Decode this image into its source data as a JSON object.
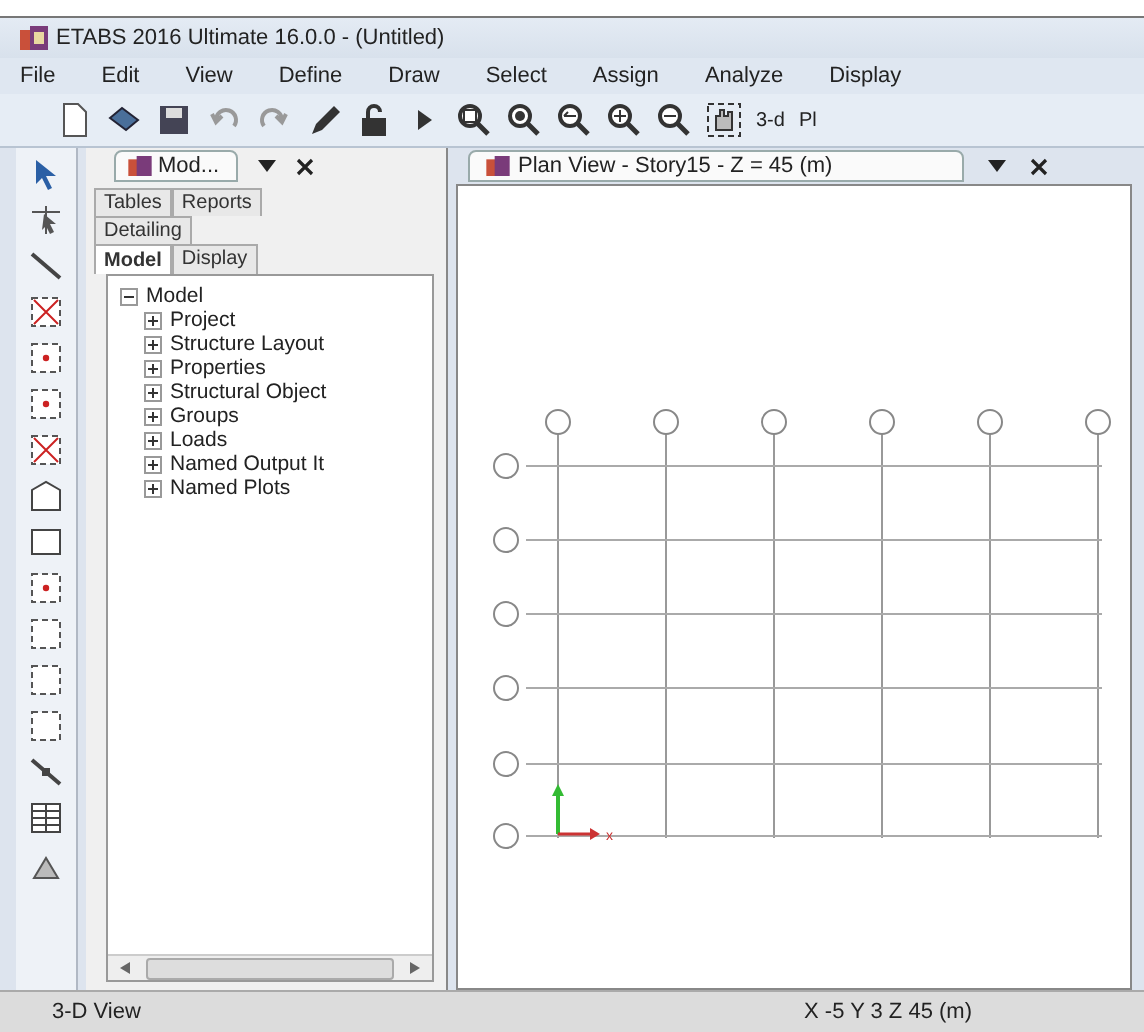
{
  "window": {
    "title": "ETABS 2016 Ultimate 16.0.0 - (Untitled)"
  },
  "menu": [
    "File",
    "Edit",
    "View",
    "Define",
    "Draw",
    "Select",
    "Assign",
    "Analyze",
    "Display"
  ],
  "toolbar": {
    "texts": [
      "3-d",
      "Pl"
    ]
  },
  "model_panel": {
    "tab": "Mod...",
    "tab_rows": [
      [
        {
          "label": "Tables",
          "selected": false
        },
        {
          "label": "Reports",
          "selected": false
        }
      ],
      [
        {
          "label": "Detailing",
          "selected": false
        }
      ],
      [
        {
          "label": "Model",
          "selected": true
        },
        {
          "label": "Display",
          "selected": false
        }
      ]
    ],
    "tree": [
      {
        "label": "Model",
        "expanded": true,
        "children": [
          {
            "label": "Project",
            "expanded": false
          },
          {
            "label": "Structure Layout",
            "expanded": false
          },
          {
            "label": "Properties",
            "expanded": false
          },
          {
            "label": "Structural Object",
            "expanded": false
          },
          {
            "label": "Groups",
            "expanded": false
          },
          {
            "label": "Loads",
            "expanded": false
          },
          {
            "label": "Named Output It",
            "expanded": false
          },
          {
            "label": "Named Plots",
            "expanded": false
          }
        ]
      }
    ]
  },
  "plan_view": {
    "tab": "Plan View - Story15 - Z = 45 (m)",
    "axis_label": "x"
  },
  "status_bar": {
    "left": "3-D View",
    "right": "X -5  Y 3  Z 45 (m)"
  }
}
